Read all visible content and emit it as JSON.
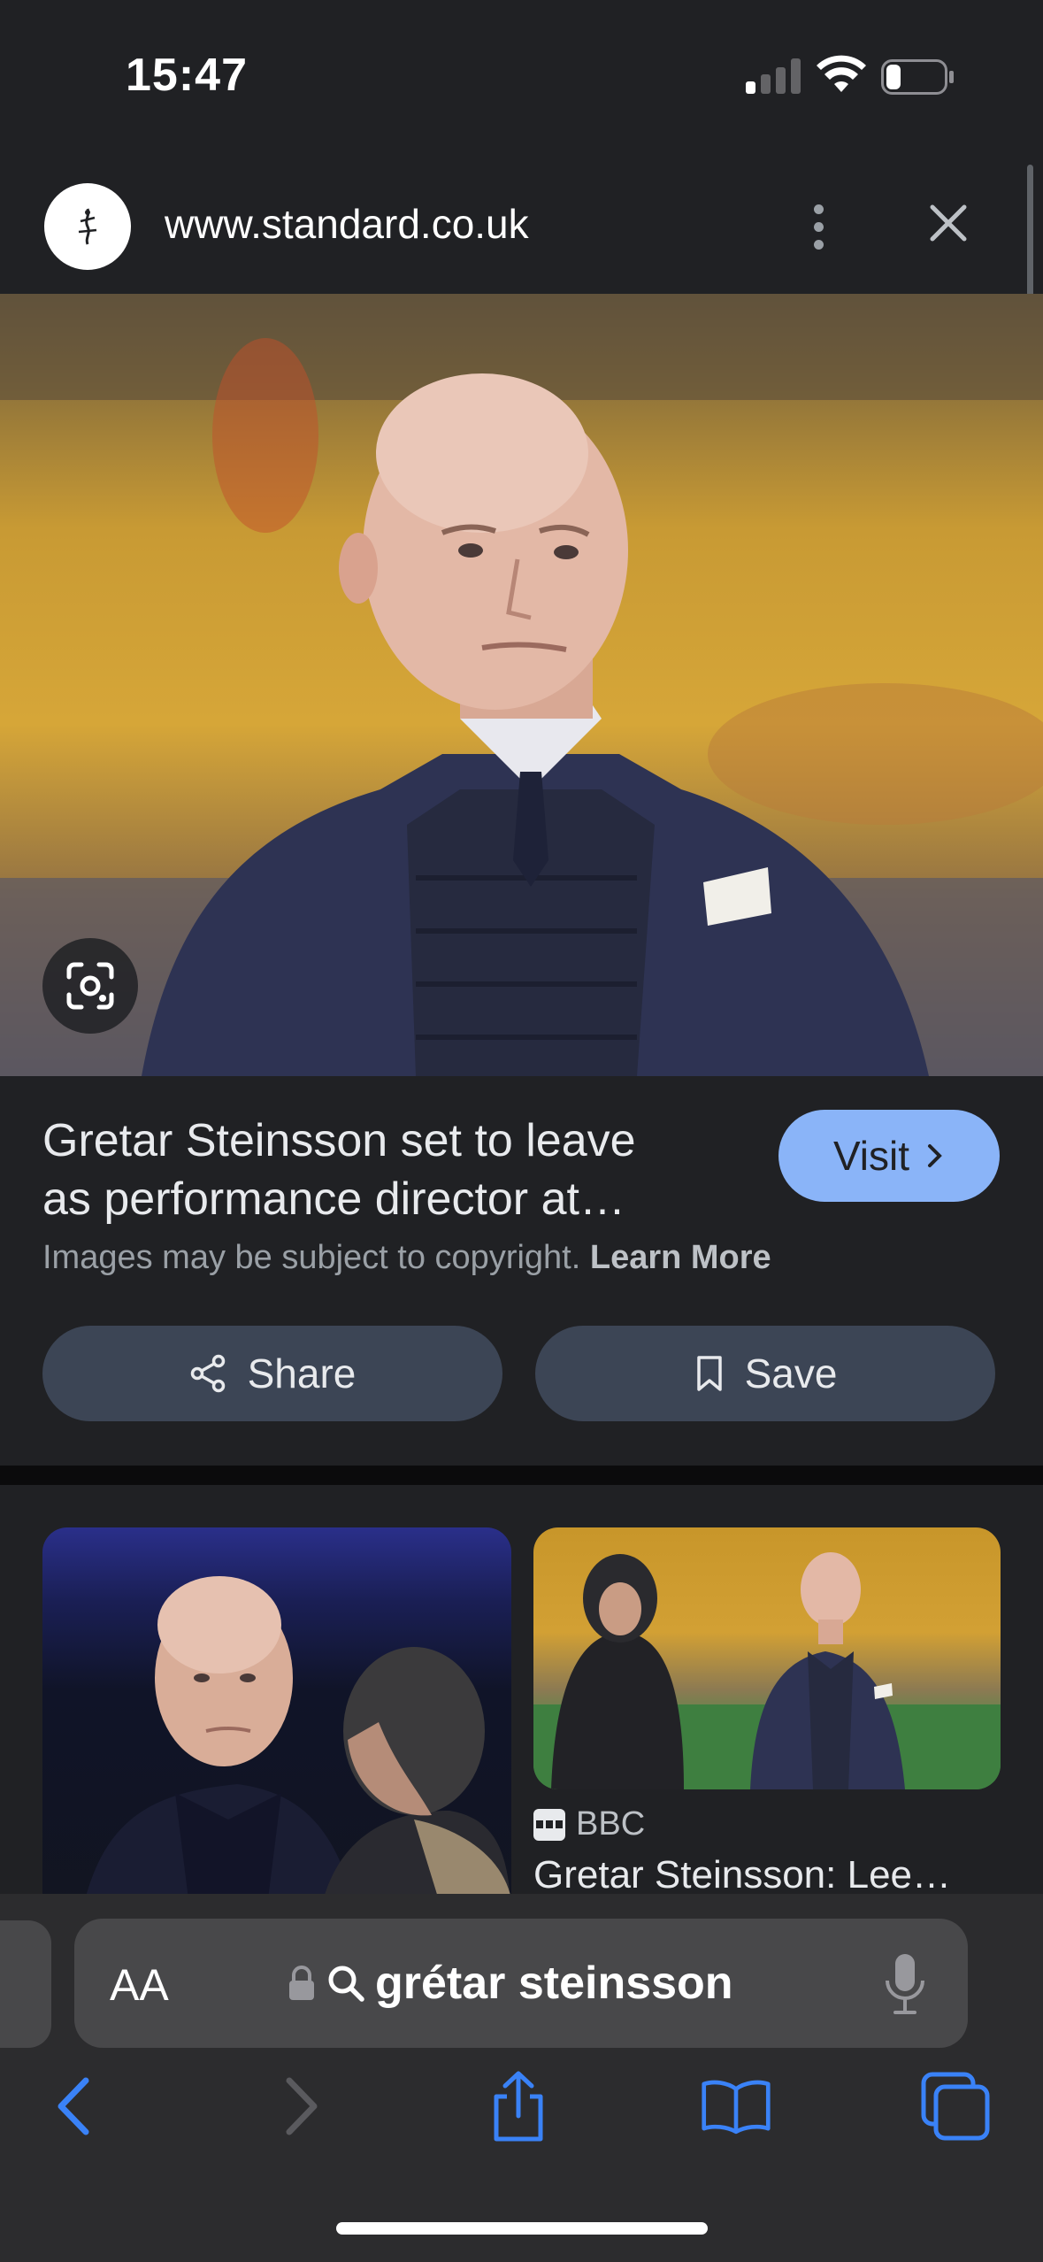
{
  "status_bar": {
    "time": "15:47"
  },
  "header": {
    "url": "www.standard.co.uk",
    "logo_icon": "standard-logo-icon"
  },
  "image_result": {
    "title_line1": "Gretar Steinsson set to leave",
    "title_line2": "as performance director at…",
    "visit_label": "Visit",
    "copyright_text": "Images may be subject to copyright.",
    "learn_more_label": "Learn More",
    "share_label": "Share",
    "save_label": "Save"
  },
  "related": {
    "source_name": "BBC",
    "result_title": "Gretar Steinsson: Lee…"
  },
  "address_bar": {
    "aa_label": "AA",
    "query": "grétar steinsson"
  },
  "colors": {
    "background": "#202124",
    "accent": "#8ab4f8",
    "button_bg": "#3c4555",
    "ios_blue": "#3a82f7"
  }
}
